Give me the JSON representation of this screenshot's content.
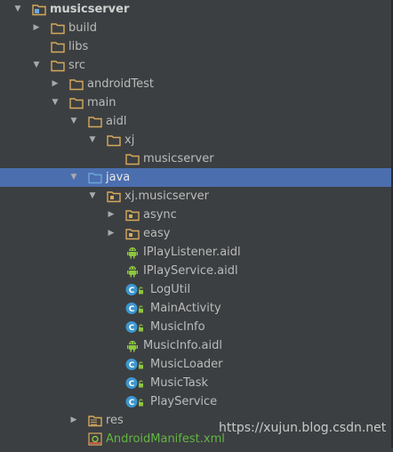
{
  "colors": {
    "background": "#3c3f41",
    "selection": "#4b6eaf",
    "text": "#bbbbbb",
    "folder": "#d7a95c",
    "java_folder": "#6ea6d8",
    "class_icon": "#3c97d0",
    "android_green": "#8dc63f",
    "manifest_text": "#62b543"
  },
  "tree": [
    {
      "label": "musicserver",
      "icon": "module-folder-icon",
      "arrow": "expanded",
      "bold": true
    },
    {
      "label": "build",
      "icon": "folder-icon",
      "arrow": "collapsed"
    },
    {
      "label": "libs",
      "icon": "folder-icon",
      "arrow": "none"
    },
    {
      "label": "src",
      "icon": "folder-icon",
      "arrow": "expanded"
    },
    {
      "label": "androidTest",
      "icon": "folder-icon",
      "arrow": "collapsed"
    },
    {
      "label": "main",
      "icon": "folder-icon",
      "arrow": "expanded"
    },
    {
      "label": "aidl",
      "icon": "folder-icon",
      "arrow": "expanded"
    },
    {
      "label": "xj",
      "icon": "folder-icon",
      "arrow": "expanded"
    },
    {
      "label": "musicserver",
      "icon": "folder-icon",
      "arrow": "none"
    },
    {
      "label": "java",
      "icon": "source-folder-icon",
      "arrow": "expanded",
      "selected": true
    },
    {
      "label": "xj.musicserver",
      "icon": "package-icon",
      "arrow": "expanded"
    },
    {
      "label": "async",
      "icon": "package-icon",
      "arrow": "collapsed"
    },
    {
      "label": "easy",
      "icon": "package-icon",
      "arrow": "collapsed"
    },
    {
      "label": "IPlayListener.aidl",
      "icon": "android-icon",
      "arrow": "none"
    },
    {
      "label": "IPlayService.aidl",
      "icon": "android-icon",
      "arrow": "none"
    },
    {
      "label": "LogUtil",
      "icon": "class-icon",
      "arrow": "none"
    },
    {
      "label": "MainActivity",
      "icon": "class-icon",
      "arrow": "none"
    },
    {
      "label": "MusicInfo",
      "icon": "class-icon",
      "arrow": "none"
    },
    {
      "label": "MusicInfo.aidl",
      "icon": "android-icon",
      "arrow": "none"
    },
    {
      "label": "MusicLoader",
      "icon": "class-icon",
      "arrow": "none"
    },
    {
      "label": "MusicTask",
      "icon": "class-icon",
      "arrow": "none"
    },
    {
      "label": "PlayService",
      "icon": "class-icon",
      "arrow": "none"
    },
    {
      "label": "res",
      "icon": "resource-folder-icon",
      "arrow": "collapsed"
    },
    {
      "label": "AndroidManifest.xml",
      "icon": "manifest-icon",
      "arrow": "none",
      "green": true
    }
  ],
  "watermark": "https://xujun.blog.csdn.net"
}
